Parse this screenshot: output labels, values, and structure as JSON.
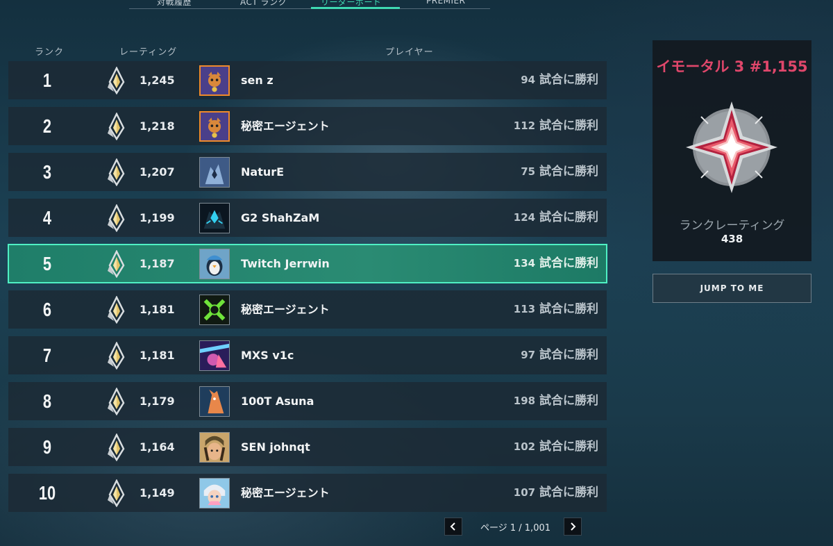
{
  "tabs": [
    {
      "label": "対戦履歴"
    },
    {
      "label": "ACT ランク"
    },
    {
      "label": "リーダーボード"
    },
    {
      "label": "PREMIER"
    }
  ],
  "columns": {
    "rank": "ランク",
    "rating": "レーティング",
    "player": "プレイヤー"
  },
  "rows": [
    {
      "rank": "1",
      "rating": "1,245",
      "name": "sen z",
      "wins_count": "94",
      "wins_suffix": "試合に勝利"
    },
    {
      "rank": "2",
      "rating": "1,218",
      "name": "秘密エージェント",
      "wins_count": "112",
      "wins_suffix": "試合に勝利"
    },
    {
      "rank": "3",
      "rating": "1,207",
      "name": "NaturE",
      "wins_count": "75",
      "wins_suffix": "試合に勝利"
    },
    {
      "rank": "4",
      "rating": "1,199",
      "name": "G2 ShahZaM",
      "wins_count": "124",
      "wins_suffix": "試合に勝利"
    },
    {
      "rank": "5",
      "rating": "1,187",
      "name": "Twitch Jerrwin",
      "wins_count": "134",
      "wins_suffix": "試合に勝利"
    },
    {
      "rank": "6",
      "rating": "1,181",
      "name": "秘密エージェント",
      "wins_count": "113",
      "wins_suffix": "試合に勝利"
    },
    {
      "rank": "7",
      "rating": "1,181",
      "name": "MXS v1c",
      "wins_count": "97",
      "wins_suffix": "試合に勝利"
    },
    {
      "rank": "8",
      "rating": "1,179",
      "name": "100T Asuna",
      "wins_count": "198",
      "wins_suffix": "試合に勝利"
    },
    {
      "rank": "9",
      "rating": "1,164",
      "name": "SEN johnqt",
      "wins_count": "102",
      "wins_suffix": "試合に勝利"
    },
    {
      "rank": "10",
      "rating": "1,149",
      "name": "秘密エージェント",
      "wins_count": "107",
      "wins_suffix": "試合に勝利"
    }
  ],
  "pagination": {
    "text": "ページ 1 / 1,001"
  },
  "rank_panel": {
    "title": "イモータル 3 #1,155",
    "rating_label": "ランクレーティング",
    "rating_value": "438"
  },
  "jump_button": "JUMP TO ME",
  "colors": {
    "accent": "#3fd9b1",
    "highlight_row": "#2a8b73",
    "rank_title": "#e0476b"
  },
  "icons": {
    "rank": "radiant-rank-icon",
    "prev": "chevron-left-icon",
    "next": "chevron-right-icon"
  }
}
